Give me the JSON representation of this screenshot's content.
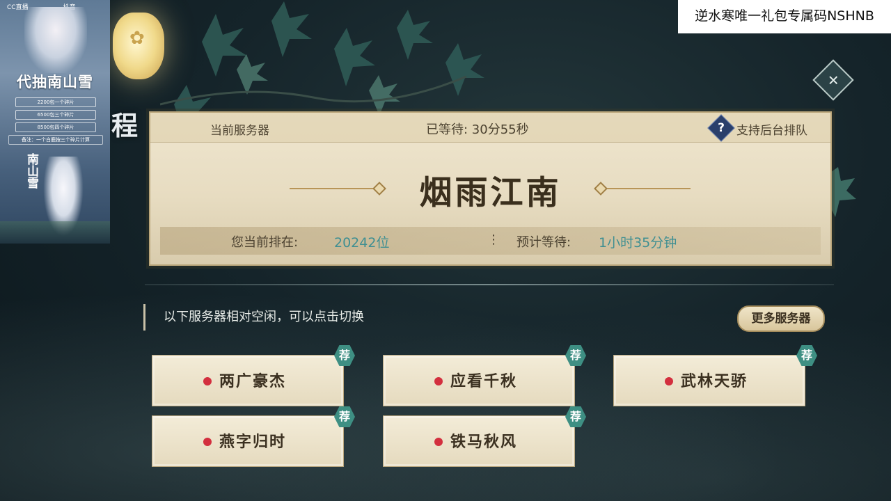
{
  "overlay": {
    "stream_logo": "CC直播",
    "douyin_logo": "抖音",
    "headline": "代抽南山雪",
    "lines": [
      "2200包一个碎片",
      "6500包三个碎片",
      "8500包四个碎片"
    ],
    "note": "备注：一个白鹿按三个碎片计算",
    "side_text": "南山雪"
  },
  "top_banner": "逆水寒唯一礼包专属码NSHNB",
  "side_char": "程",
  "card": {
    "current_server_label": "当前服务器",
    "waited_label": "已等待: 30分55秒",
    "background_queue_label": "支持后台排队",
    "help_glyph": "?",
    "server_name": "烟雨江南",
    "rank_label": "您当前排在:",
    "rank_value": "20242位",
    "separator": "⋮",
    "eta_label": "预计等待:",
    "eta_value": "1小时35分钟"
  },
  "hint": "以下服务器相对空闲，可以点击切换",
  "more_servers": "更多服务器",
  "rec_badge": "荐",
  "servers": [
    {
      "name": "两广豪杰"
    },
    {
      "name": "应看千秋"
    },
    {
      "name": "武林天骄"
    },
    {
      "name": "燕字归时"
    },
    {
      "name": "铁马秋风"
    }
  ],
  "icons": {
    "close": "close-icon",
    "help": "question-icon",
    "dot": "status-dot-icon"
  },
  "colors": {
    "accent_teal": "#3f8f92",
    "dot_red": "#d32f3e",
    "badge_green": "#3e8f83"
  }
}
